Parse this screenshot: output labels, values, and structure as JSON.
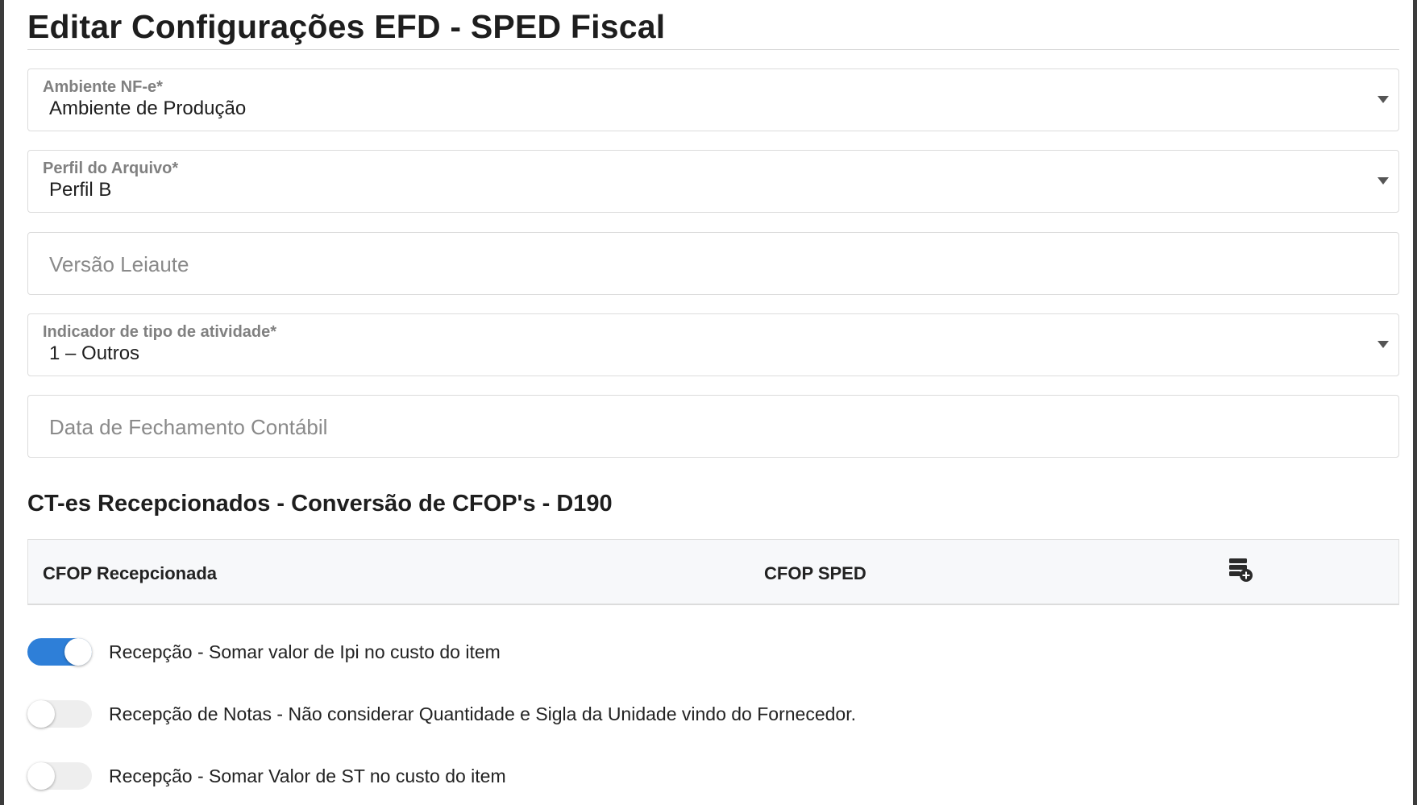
{
  "page": {
    "title": "Editar Configurações EFD - SPED Fiscal"
  },
  "fields": {
    "ambiente": {
      "label": "Ambiente NF-e*",
      "value": "Ambiente de Produção"
    },
    "perfil": {
      "label": "Perfil do Arquivo*",
      "value": "Perfil B"
    },
    "versao": {
      "placeholder": "Versão Leiaute"
    },
    "indicador": {
      "label": "Indicador de tipo de atividade*",
      "value": "1 – Outros"
    },
    "data_fechamento": {
      "placeholder": "Data de Fechamento Contábil"
    }
  },
  "cfop_section": {
    "title": "CT-es Recepcionados - Conversão de CFOP's - D190",
    "col_recepcionada": "CFOP Recepcionada",
    "col_sped": "CFOP SPED",
    "add_icon": "add-row-icon"
  },
  "toggles": [
    {
      "label": "Recepção - Somar valor de Ipi no custo do item",
      "checked": true
    },
    {
      "label": "Recepção de Notas - Não considerar Quantidade e Sigla da Unidade vindo do Fornecedor.",
      "checked": false
    },
    {
      "label": "Recepção - Somar Valor de ST no custo do item",
      "checked": false
    }
  ],
  "colors": {
    "toggle_on": "#2e7fd8",
    "toggle_off": "#eeeeee",
    "frame_border": "#3b3b3b"
  }
}
